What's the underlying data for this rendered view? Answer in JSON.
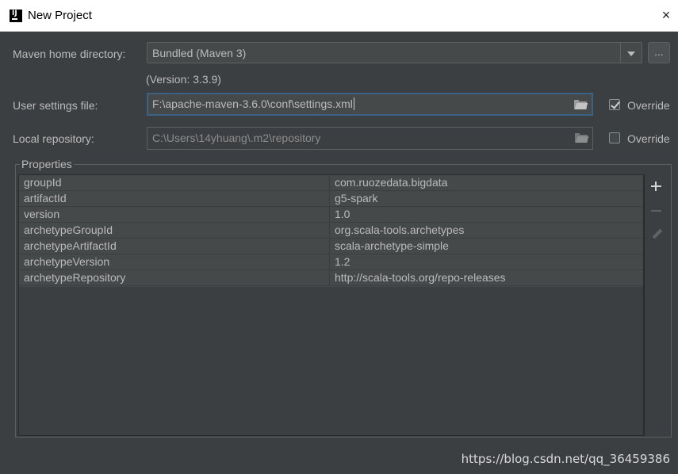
{
  "window": {
    "title": "New Project",
    "close_label": "×"
  },
  "maven_home": {
    "label": "Maven home directory:",
    "value": "Bundled (Maven 3)",
    "browse_label": "...",
    "version_note": "(Version: 3.3.9)"
  },
  "user_settings": {
    "label": "User settings file:",
    "value": "F:\\apache-maven-3.6.0\\conf\\settings.xml",
    "override_label": "Override",
    "override_checked": true
  },
  "local_repo": {
    "label": "Local repository:",
    "value": "C:\\Users\\14yhuang\\.m2\\repository",
    "override_label": "Override",
    "override_checked": false
  },
  "properties": {
    "title": "Properties",
    "rows": [
      {
        "key": "groupId",
        "value": "com.ruozedata.bigdata"
      },
      {
        "key": "artifactId",
        "value": "g5-spark"
      },
      {
        "key": "version",
        "value": "1.0"
      },
      {
        "key": "archetypeGroupId",
        "value": "org.scala-tools.archetypes"
      },
      {
        "key": "archetypeArtifactId",
        "value": "scala-archetype-simple"
      },
      {
        "key": "archetypeVersion",
        "value": "1.2"
      },
      {
        "key": "archetypeRepository",
        "value": "http://scala-tools.org/repo-releases"
      }
    ]
  },
  "watermark": "https://blog.csdn.net/qq_36459386",
  "colors": {
    "background": "#3c3f41",
    "field": "#45494a",
    "focus_border": "#3d6185",
    "text": "#bbbbbb"
  }
}
